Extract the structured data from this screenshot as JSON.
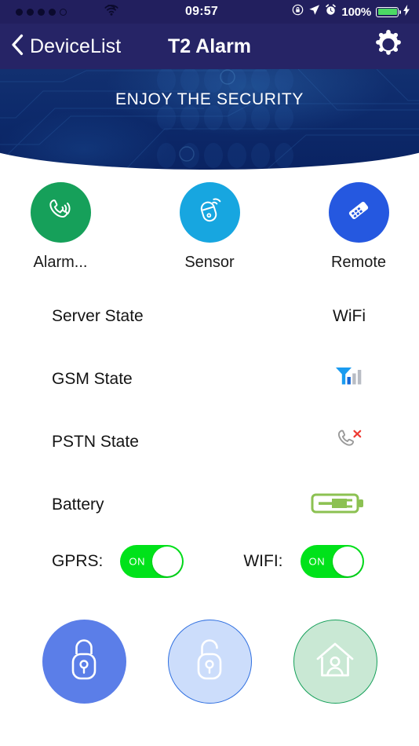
{
  "status_bar": {
    "signal_dots_total": 5,
    "signal_dots_filled": 4,
    "wifi_icon": "wifi-icon",
    "time": "09:57",
    "rotation_lock_icon": "rotation-lock-icon",
    "location_icon": "location-arrow-icon",
    "alarm_icon": "alarm-clock-icon",
    "battery_percent": "100%",
    "battery_icon": "battery-full-icon",
    "charging_icon": "lightning-bolt-icon"
  },
  "navbar": {
    "back_icon": "chevron-left-icon",
    "back_label": "DeviceList",
    "title": "T2 Alarm",
    "settings_icon": "gear-icon"
  },
  "banner": {
    "title": "ENJOY THE SECURITY",
    "background_color": "#0d2a6b"
  },
  "quick_actions": [
    {
      "label": "Alarm...",
      "icon": "phone-ringing-icon",
      "color": "#16a05a"
    },
    {
      "label": "Sensor",
      "icon": "motion-sensor-icon",
      "color": "#17a6e0"
    },
    {
      "label": "Remote",
      "icon": "remote-control-icon",
      "color": "#2558e0"
    }
  ],
  "status_rows": [
    {
      "label": "Server State",
      "value": "WiFi",
      "value_type": "text"
    },
    {
      "label": "GSM State",
      "value": "",
      "value_type": "icon",
      "icon": "gsm-signal-bars-icon",
      "bars_active": 2,
      "bars_total": 4
    },
    {
      "label": "PSTN State",
      "value": "",
      "value_type": "icon",
      "icon": "phone-disconnected-icon"
    },
    {
      "label": "Battery",
      "value": "",
      "value_type": "icon",
      "icon": "battery-charging-icon"
    }
  ],
  "toggles": [
    {
      "label": "GPRS:",
      "state_text": "ON",
      "on": true,
      "color": "#00e21a"
    },
    {
      "label": "WIFI:",
      "state_text": "ON",
      "on": true,
      "color": "#00e21a"
    }
  ],
  "arm_buttons": [
    {
      "name": "arm",
      "icon": "padlock-locked-icon",
      "fill": "#5b7ee8",
      "border": ""
    },
    {
      "name": "disarm",
      "icon": "padlock-unlocked-icon",
      "fill": "#ccddfb",
      "border": "#2f6fe0"
    },
    {
      "name": "home",
      "icon": "home-person-icon",
      "fill": "#c9e8d4",
      "border": "#16a05a"
    }
  ]
}
